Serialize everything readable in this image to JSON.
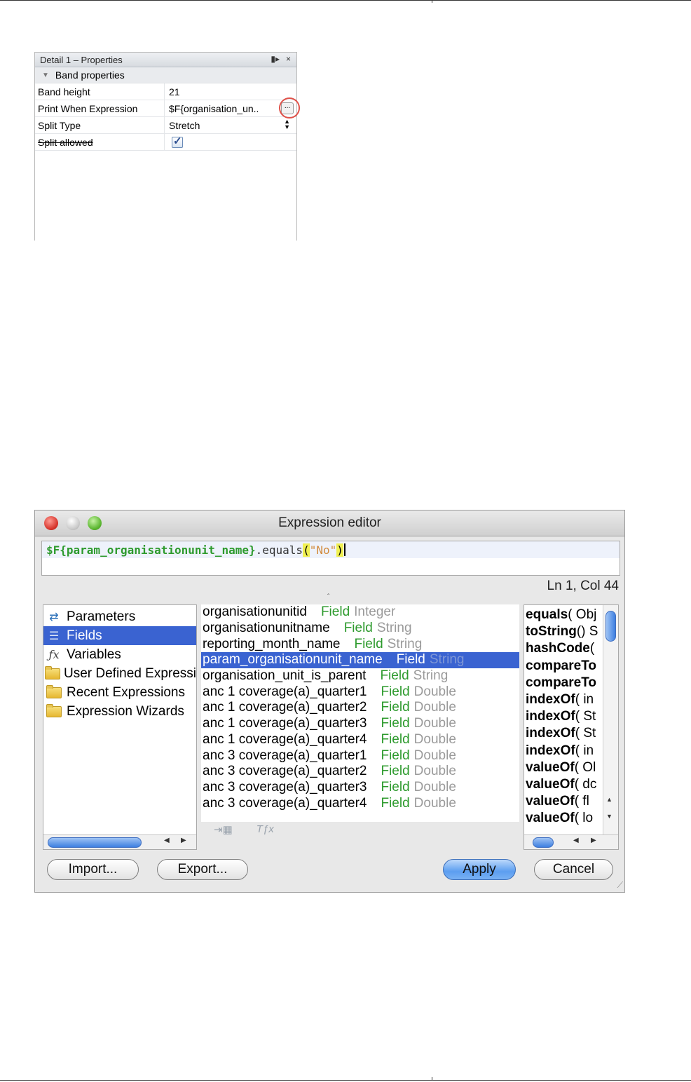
{
  "properties_panel": {
    "title": "Detail 1 – Properties",
    "ctrl_pin": "▮▸",
    "ctrl_close": "×",
    "section": "Band properties",
    "rows": [
      {
        "key": "Band height",
        "value": "21"
      },
      {
        "key": "Print When Expression",
        "value": "$F{organisation_un..",
        "button": "..."
      },
      {
        "key": "Split Type",
        "value": "Stretch"
      },
      {
        "key": "Split allowed",
        "checked": true
      }
    ]
  },
  "expression_editor": {
    "title": "Expression editor",
    "expression": {
      "field": "$F{param_organisationunit_name}",
      "method": ".equals",
      "open_paren": "(",
      "string": "\"No\"",
      "close_paren": ")"
    },
    "status": "Ln 1, Col 44",
    "categories": [
      {
        "label": "Parameters",
        "icon": "parameters-icon",
        "glyph": "⇄"
      },
      {
        "label": "Fields",
        "icon": "fields-icon",
        "glyph": "☰",
        "selected": true
      },
      {
        "label": "Variables",
        "icon": "function-icon",
        "glyph": "ƒx"
      },
      {
        "label": "User Defined Expressions",
        "icon": "folder-icon"
      },
      {
        "label": "Recent Expressions",
        "icon": "folder-icon"
      },
      {
        "label": "Expression Wizards",
        "icon": "folder-icon"
      }
    ],
    "fields": [
      {
        "name": "organisationunitid",
        "kind": "Field",
        "class": "Integer"
      },
      {
        "name": "organisationunitname",
        "kind": "Field",
        "class": "String"
      },
      {
        "name": "reporting_month_name",
        "kind": "Field",
        "class": "String"
      },
      {
        "name": "param_organisationunit_name",
        "kind": "Field",
        "class": "String",
        "selected": true
      },
      {
        "name": "organisation_unit_is_parent",
        "kind": "Field",
        "class": "String"
      },
      {
        "name": "anc 1 coverage(a)_quarter1",
        "kind": "Field",
        "class": "Double"
      },
      {
        "name": "anc 1 coverage(a)_quarter2",
        "kind": "Field",
        "class": "Double"
      },
      {
        "name": "anc 1 coverage(a)_quarter3",
        "kind": "Field",
        "class": "Double"
      },
      {
        "name": "anc 1 coverage(a)_quarter4",
        "kind": "Field",
        "class": "Double"
      },
      {
        "name": "anc 3 coverage(a)_quarter1",
        "kind": "Field",
        "class": "Double"
      },
      {
        "name": "anc 3 coverage(a)_quarter2",
        "kind": "Field",
        "class": "Double"
      },
      {
        "name": "anc 3 coverage(a)_quarter3",
        "kind": "Field",
        "class": "Double"
      },
      {
        "name": "anc 3 coverage(a)_quarter4",
        "kind": "Field",
        "class": "Double"
      }
    ],
    "methods": [
      {
        "name": "equals",
        "rest": "( Obj"
      },
      {
        "name": "toString",
        "rest": "() S"
      },
      {
        "name": "hashCode",
        "rest": "("
      },
      {
        "name": "compareTo",
        "rest": ""
      },
      {
        "name": "compareTo",
        "rest": ""
      },
      {
        "name": "indexOf",
        "rest": "( in"
      },
      {
        "name": "indexOf",
        "rest": "( St"
      },
      {
        "name": "indexOf",
        "rest": "( St"
      },
      {
        "name": "indexOf",
        "rest": "( in"
      },
      {
        "name": "valueOf",
        "rest": "( Ol"
      },
      {
        "name": "valueOf",
        "rest": "( dc"
      },
      {
        "name": "valueOf",
        "rest": "( fl"
      },
      {
        "name": "valueOf",
        "rest": "( lo"
      }
    ],
    "buttons": {
      "import": "Import...",
      "export": "Export...",
      "apply": "Apply",
      "cancel": "Cancel"
    },
    "colors": {
      "selection": "#3a63d1",
      "field_type": "#2d9a2d",
      "string_literal": "#d28a3b"
    }
  }
}
